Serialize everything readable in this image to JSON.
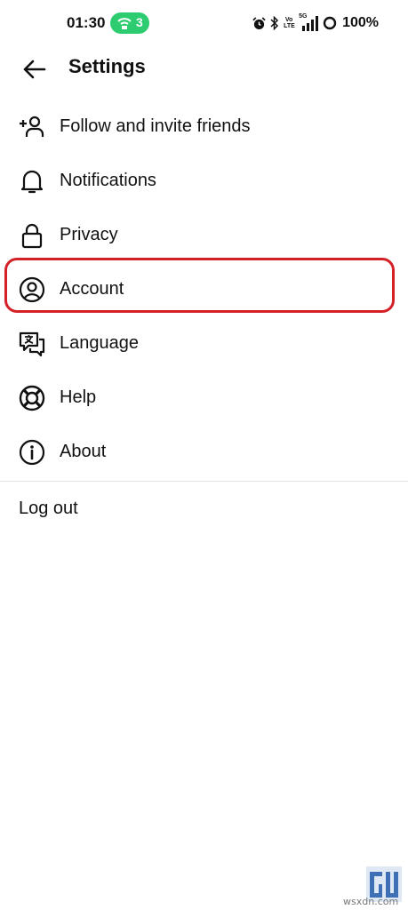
{
  "status_bar": {
    "time": "01:30",
    "hotspot_count": "3",
    "volte_line1": "Vo",
    "volte_line2": "LTE",
    "network": "5G",
    "battery": "100%",
    "icons": [
      "alarm-icon",
      "bluetooth-icon",
      "volte-icon",
      "signal-5g-icon",
      "battery-ring-icon"
    ]
  },
  "header": {
    "title": "Settings",
    "back_icon": "arrow-left-icon"
  },
  "menu": {
    "items": [
      {
        "label": "Follow and invite friends",
        "icon": "add-person-icon"
      },
      {
        "label": "Notifications",
        "icon": "bell-icon"
      },
      {
        "label": "Privacy",
        "icon": "lock-icon"
      },
      {
        "label": "Account",
        "icon": "account-circle-icon",
        "highlighted": true
      },
      {
        "label": "Language",
        "icon": "translate-icon"
      },
      {
        "label": "Help",
        "icon": "lifebuoy-icon"
      },
      {
        "label": "About",
        "icon": "info-icon"
      }
    ]
  },
  "logout_label": "Log out",
  "colors": {
    "highlight": "#d42027",
    "hotspot": "#2ecc71",
    "text": "#111111",
    "divider": "#e3e3e3"
  },
  "watermark": {
    "logo": "gadgets-to-use-logo",
    "text": "wsxdn.com"
  }
}
